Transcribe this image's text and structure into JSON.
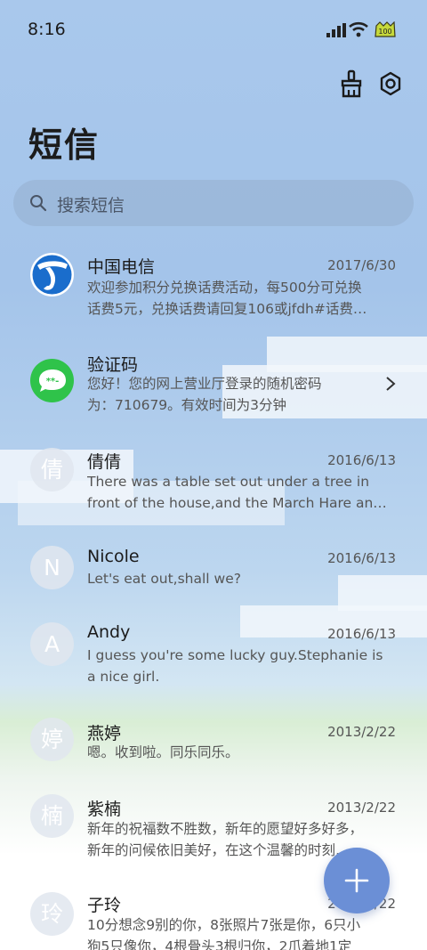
{
  "status": {
    "time": "8:16",
    "battery": "100"
  },
  "header": {
    "title": "短信",
    "clean_icon": "broom-icon",
    "settings_icon": "settings-icon"
  },
  "search": {
    "placeholder": "搜索短信"
  },
  "conversations": [
    {
      "name": "中国电信",
      "date": "2017/6/30",
      "avatar": "",
      "line1": "欢迎参加积分兑换话费活动，每500分可兑换",
      "line2": "话费5元，兑换话费请回复106或jfdh#话费…"
    },
    {
      "name": "验证码",
      "date": "",
      "avatar": "",
      "line1": "您好！您的网上营业厅登录的随机密码",
      "line2": "为：710679。有效时间为3分钟"
    },
    {
      "name": "倩倩",
      "date": "2016/6/13",
      "avatar": "倩",
      "line1": "There was a table set out under a tree in",
      "line2": "front of the house,and the March Hare an…"
    },
    {
      "name": "Nicole",
      "date": "2016/6/13",
      "avatar": "N",
      "line1": "Let's eat out,shall we?",
      "line2": ""
    },
    {
      "name": "Andy",
      "date": "2016/6/13",
      "avatar": "A",
      "line1": "I guess you're some lucky guy.Stephanie is",
      "line2": "a nice girl."
    },
    {
      "name": "燕婷",
      "date": "2013/2/22",
      "avatar": "婷",
      "line1": "嗯。收到啦。同乐同乐。",
      "line2": ""
    },
    {
      "name": "紫楠",
      "date": "2013/2/22",
      "avatar": "楠",
      "line1": "新年的祝福数不胜数，新年的愿望好多好多，",
      "line2": "新年的问候依旧美好，在这个温馨的时刻…"
    },
    {
      "name": "子玲",
      "date": "2013/2/22",
      "avatar": "玲",
      "line1": "10分想念9别的你，8张照片7张是你，6只小",
      "line2": "狗5只像你，4根骨头3根归你，2爪着地1定"
    }
  ],
  "fab": {
    "icon": "plus-icon"
  }
}
